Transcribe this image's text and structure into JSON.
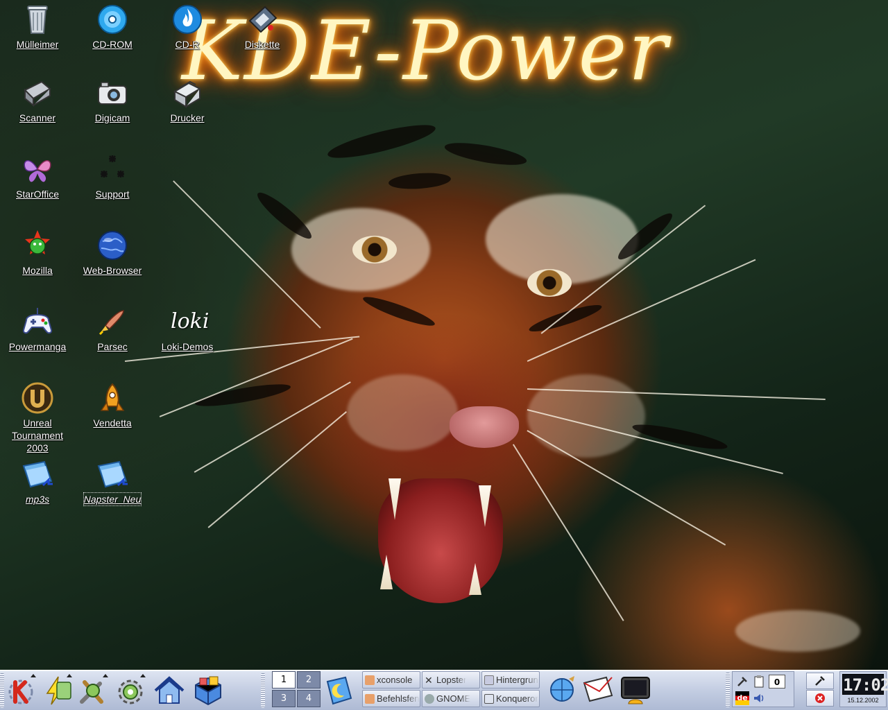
{
  "wallpaper": {
    "title": "KDE-Power",
    "accent": "#ff8a20"
  },
  "desktop_icons": [
    {
      "id": "muelleimer",
      "label": "Mülleimer",
      "icon": "trash-icon"
    },
    {
      "id": "cdrom",
      "label": "CD-ROM",
      "icon": "cdrom-icon"
    },
    {
      "id": "cdr",
      "label": "CD-R",
      "icon": "cdr-burn-icon"
    },
    {
      "id": "diskette",
      "label": "Diskette",
      "icon": "floppy-icon"
    },
    {
      "id": "scanner",
      "label": "Scanner",
      "icon": "scanner-icon"
    },
    {
      "id": "digicam",
      "label": "Digicam",
      "icon": "camera-icon"
    },
    {
      "id": "drucker",
      "label": "Drucker",
      "icon": "printer-icon"
    },
    {
      "id": "staroffice",
      "label": "StarOffice",
      "icon": "butterfly-icon"
    },
    {
      "id": "support",
      "label": "Support",
      "icon": "support-icon"
    },
    {
      "id": "mozilla",
      "label": "Mozilla",
      "icon": "mozilla-icon"
    },
    {
      "id": "webbrowser",
      "label": "Web-Browser",
      "icon": "globe-icon"
    },
    {
      "id": "powermanga",
      "label": "Powermanga",
      "icon": "gamepad-icon"
    },
    {
      "id": "parsec",
      "label": "Parsec",
      "icon": "rocket-icon"
    },
    {
      "id": "lokidemos",
      "label": "Loki-Demos",
      "icon": "loki-icon",
      "glyph_text": "loki"
    },
    {
      "id": "unreal",
      "label": "Unreal\nTournament\n2003",
      "icon": "unreal-icon"
    },
    {
      "id": "vendetta",
      "label": "Vendetta",
      "icon": "vendetta-ship-icon"
    },
    {
      "id": "mp3s",
      "label": "mp3s",
      "icon": "folder-link-icon"
    },
    {
      "id": "napster",
      "label": "Napster_Neu",
      "icon": "folder-link-icon"
    }
  ],
  "panel": {
    "launchers": [
      {
        "id": "kmenu",
        "icon": "k-menu-icon"
      },
      {
        "id": "power",
        "icon": "lightning-icon"
      },
      {
        "id": "settings",
        "icon": "tools-icon"
      },
      {
        "id": "control-center",
        "icon": "gear-icon"
      },
      {
        "id": "home",
        "icon": "home-icon"
      },
      {
        "id": "package",
        "icon": "package-icon"
      }
    ],
    "pager": [
      "1",
      "2",
      "3",
      "4"
    ],
    "active_desktop": "1",
    "tasks": [
      {
        "label": "xconsole",
        "icon": "konsole-icon"
      },
      {
        "label": "Lopster",
        "icon": "x-icon"
      },
      {
        "label": "Hintergrund",
        "icon": "image-icon"
      },
      {
        "label": "Befehlsfenster",
        "icon": "konsole-icon"
      },
      {
        "label": "GNOME",
        "icon": "gnome-icon"
      },
      {
        "label": "Konqueror",
        "icon": "kde-icon"
      }
    ],
    "apps_right": [
      {
        "id": "browser",
        "icon": "globe-icon"
      },
      {
        "id": "mail",
        "icon": "mail-icon"
      },
      {
        "id": "terminal",
        "icon": "shell-terminal-icon"
      }
    ],
    "tray": {
      "keyboard_layout": "de",
      "klipper_count": "0"
    },
    "clock": {
      "time": "17:02",
      "date": "15.12.2002"
    }
  }
}
